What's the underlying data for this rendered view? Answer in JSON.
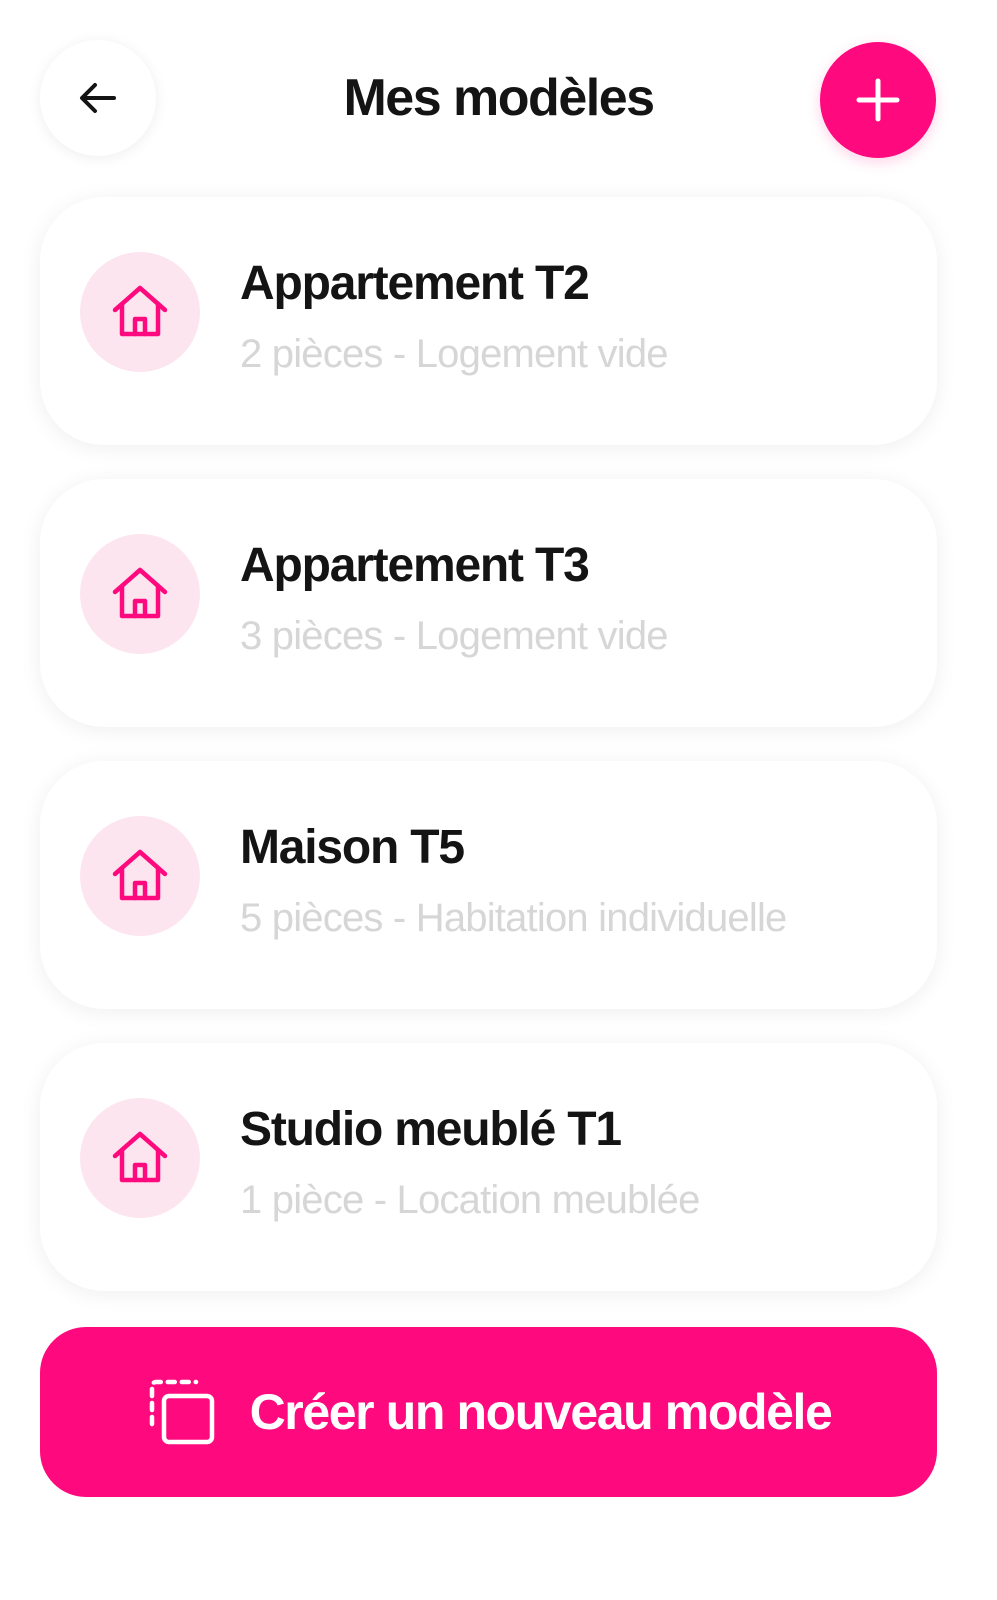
{
  "header": {
    "title": "Mes modèles",
    "back_icon": "arrow-left-icon",
    "add_icon": "plus-icon"
  },
  "colors": {
    "accent": "#ff0a7e",
    "icon_bg": "#fde5ef",
    "title_text": "#141414",
    "subtitle_text": "#d6d6d6"
  },
  "models": [
    {
      "icon": "house-icon",
      "title": "Appartement T2",
      "subtitle": "2 pièces - Logement vide"
    },
    {
      "icon": "house-icon",
      "title": "Appartement T3",
      "subtitle": "3 pièces - Logement vide"
    },
    {
      "icon": "house-icon",
      "title": "Maison T5",
      "subtitle": "5 pièces - Habitation individuelle"
    },
    {
      "icon": "house-icon",
      "title": "Studio meublé T1",
      "subtitle": "1 pièce - Location meublée"
    }
  ],
  "footer": {
    "create_label": "Créer un nouveau modèle",
    "create_icon": "duplicate-icon"
  }
}
